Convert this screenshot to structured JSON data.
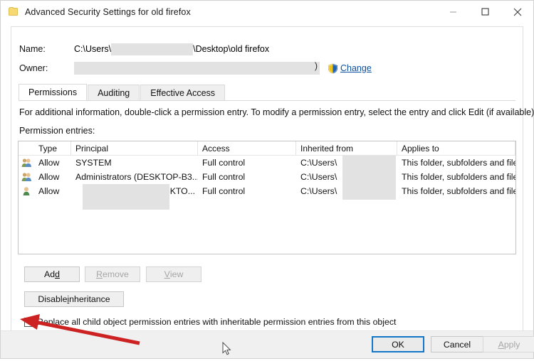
{
  "window": {
    "title": "Advanced Security Settings for old firefox",
    "icon": "folder-icon",
    "controls": {
      "minimize": "minimize-icon",
      "maximize": "maximize-icon",
      "close": "close-icon"
    }
  },
  "header": {
    "name_label": "Name:",
    "name_value_prefix": "C:\\Users\\",
    "name_value_suffix": "\\Desktop\\old firefox",
    "owner_label": "Owner:",
    "owner_value": "",
    "owner_paren": ")",
    "change_link": "Change",
    "change_accel": "C",
    "change_rest": "hange",
    "shield_icon": "uac-shield-icon"
  },
  "tabs": [
    {
      "label": "Permissions",
      "active": true
    },
    {
      "label": "Auditing",
      "active": false
    },
    {
      "label": "Effective Access",
      "active": false
    }
  ],
  "main": {
    "info_text": "For additional information, double-click a permission entry. To modify a permission entry, select the entry and click Edit (if available).",
    "entries_label": "Permission entries:"
  },
  "table": {
    "columns": [
      "",
      "Type",
      "Principal",
      "Access",
      "Inherited from",
      "Applies to"
    ],
    "rows": [
      {
        "icon": "group-icon",
        "type": "Allow",
        "principal": "SYSTEM",
        "access": "Full control",
        "inherited_from": "C:\\Users\\",
        "inherited_suffix": "..",
        "applies_to": "This folder, subfolders and files"
      },
      {
        "icon": "group-icon",
        "type": "Allow",
        "principal": "Administrators (DESKTOP-B3...",
        "access": "Full control",
        "inherited_from": "C:\\Users\\",
        "inherited_suffix": "..",
        "applies_to": "This folder, subfolders and files"
      },
      {
        "icon": "user-icon",
        "type": "Allow",
        "principal": "DESKTO...",
        "access": "Full control",
        "inherited_from": "C:\\Users\\",
        "inherited_suffix": "..",
        "applies_to": "This folder, subfolders and files"
      }
    ]
  },
  "buttons": {
    "add": {
      "accel": "d",
      "before": "Ad",
      "after": "",
      "enabled": true
    },
    "remove": {
      "accel": "R",
      "before": "",
      "after": "emove",
      "enabled": false
    },
    "view": {
      "accel": "V",
      "before": "",
      "after": "iew",
      "enabled": false
    },
    "disable_inheritance": {
      "before": "Disable ",
      "accel": "i",
      "after": "nheritance",
      "enabled": true
    }
  },
  "checkbox": {
    "label": "Replace all child object permission entries with inheritable permission entries from this object",
    "checked": false
  },
  "footer": {
    "ok": "OK",
    "cancel": "Cancel",
    "apply_accel": "A",
    "apply_rest": "pply",
    "apply_enabled": false
  },
  "annotation": {
    "arrow_color": "#cc2222",
    "target": "replace-child-permissions-checkbox"
  },
  "colors": {
    "accent": "#1277c9",
    "link": "#0b4f9e",
    "redaction": "#e2e2e2",
    "dialog_bg": "#ffffff",
    "footer_bg": "#f0f0f0"
  }
}
